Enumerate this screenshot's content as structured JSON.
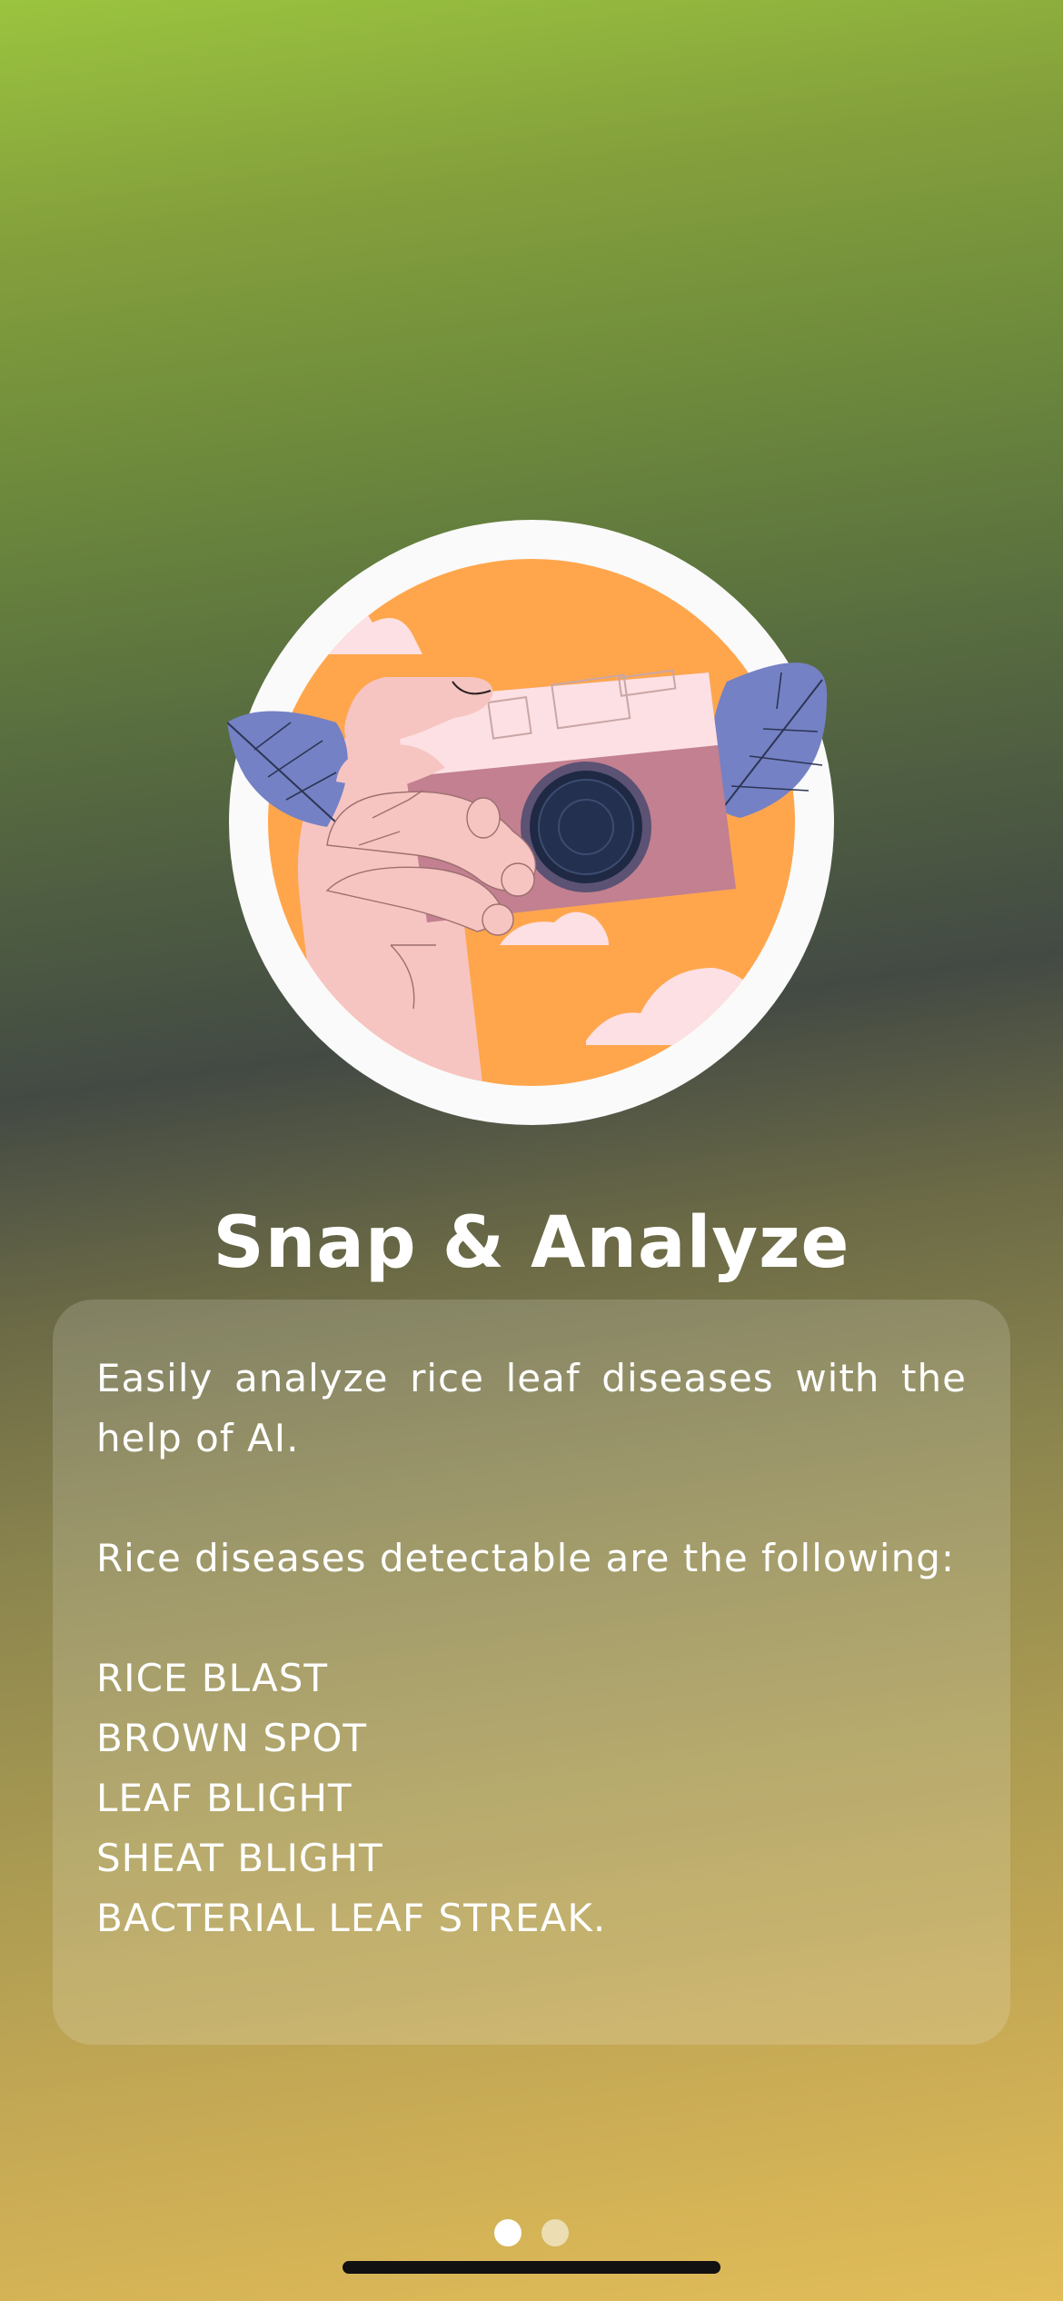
{
  "onboarding": {
    "title": "Snap & Analyze",
    "intro": "Easily analyze rice leaf diseases with the help of AI.",
    "list_heading": "Rice diseases detectable are the following:",
    "diseases": [
      "RICE BLAST",
      "BROWN SPOT",
      "LEAF BLIGHT",
      "SHEAT BLIGHT",
      "BACTERIAL LEAF STREAK."
    ],
    "illustration_icon": "hand-holding-camera-icon"
  },
  "pagination": {
    "current_page": 1,
    "total_pages": 2
  },
  "colors": {
    "accent_orange": "#ffa64d",
    "leaf_blue": "#7481c5",
    "camera_pink": "#c28090",
    "text": "#ffffff"
  }
}
